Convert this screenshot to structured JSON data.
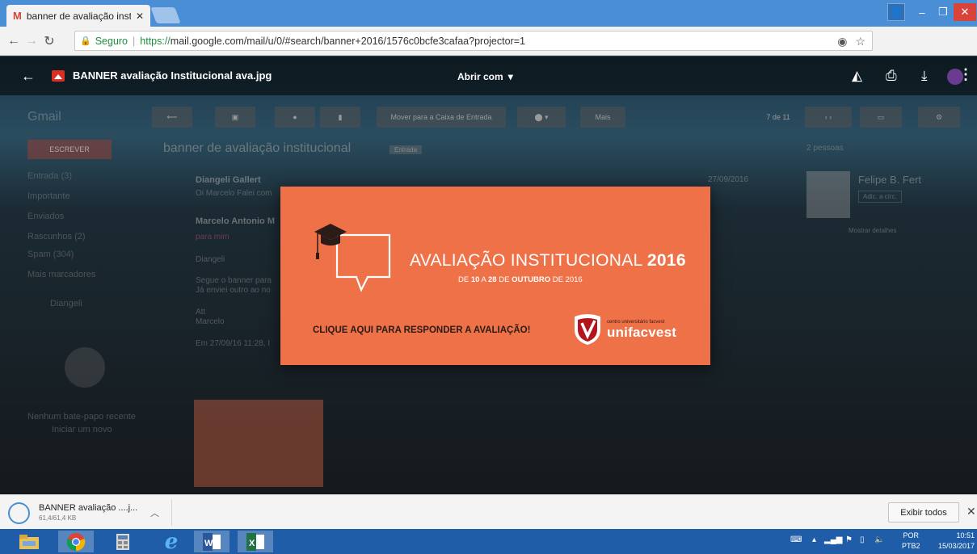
{
  "browser": {
    "tab_title": "banner de avaliação insti",
    "tab_favicon": "M",
    "secure_label": "Seguro",
    "url_scheme": "https://",
    "url_rest": "mail.google.com/mail/u/0/#search/banner+2016/1576c0bcfe3cafaa?projector=1"
  },
  "viewer": {
    "filename": "BANNER avaliação Institucional ava.jpg",
    "open_with": "Abrir com"
  },
  "gmail": {
    "logo": "Gmail",
    "compose": "ESCREVER",
    "nav": [
      "Entrada (3)",
      "Importante",
      "Enviados",
      "Rascunhos (2)",
      "Spam (304)",
      "Mais marcadores"
    ],
    "contact": "Diangeli",
    "hangouts_empty": "Nenhum bate-papo recente",
    "hangouts_start": "Iniciar um novo",
    "toolbar": {
      "move_inbox": "Mover para a Caixa de Entrada",
      "more": "Mais",
      "counter": "7 de 11"
    },
    "subject": "banner de avaliação institucional",
    "label": "Entrada",
    "messages": [
      {
        "sender": "Diangeli Gallert",
        "snippet": "Oi Marcelo Falei com",
        "date": "27/09/2016"
      },
      {
        "sender": "Marcelo Antonio M",
        "to": "para mim"
      }
    ],
    "body_lines": [
      "Diangeli",
      "Segue o banner para",
      "Já enviei outro ao no",
      "Att",
      "Marcelo",
      "Em 27/09/16 11:28, I"
    ],
    "people_header": "2 pessoas",
    "person_name": "Felipe B. Fert",
    "add_circle": "Adic. a círc.",
    "show_details": "Mostrar detalhes"
  },
  "banner": {
    "title": "AVALIAÇÃO INSTITUCIONAL",
    "year": "2016",
    "date_de": "DE",
    "date_from": "10",
    "date_a": "A",
    "date_to": "28",
    "date_of": "DE",
    "date_month": "OUTUBRO",
    "date_year": "DE 2016",
    "cta": "CLIQUE AQUI PARA RESPONDER A AVALIAÇÃO!",
    "logo_sub": "centro universitário facvest",
    "logo_name": "unifacvest",
    "color": "#ee7148"
  },
  "download": {
    "filename": "BANNER avaliação ....j...",
    "size": "61,4/61,4 KB",
    "show_all": "Exibir todos"
  },
  "taskbar": {
    "lang_top": "POR",
    "lang_bottom": "PTB2",
    "time": "10:51",
    "date": "15/03/2017"
  }
}
